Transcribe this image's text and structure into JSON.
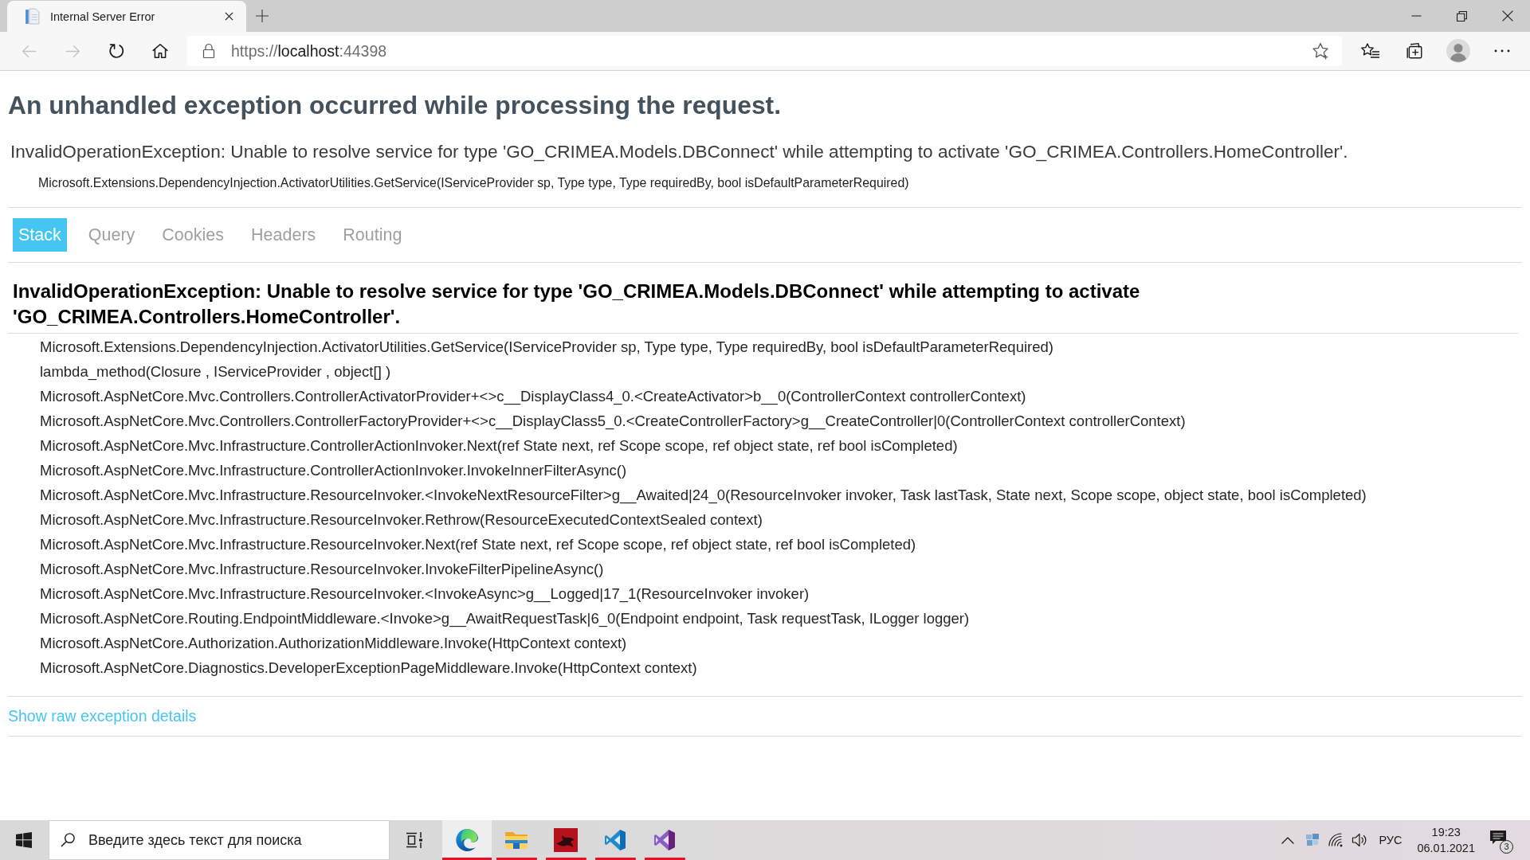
{
  "browser": {
    "tab": {
      "title": "Internal Server Error"
    },
    "toolbar": {
      "back": {
        "disabled": true
      },
      "forward": {
        "disabled": true
      },
      "url": {
        "scheme": "https://",
        "host": "localhost",
        "port": ":44398"
      }
    }
  },
  "page": {
    "title": "An unhandled exception occurred while processing the request.",
    "error_message": "InvalidOperationException: Unable to resolve service for type 'GO_CRIMEA.Models.DBConnect' while attempting to activate 'GO_CRIMEA.Controllers.HomeController'.",
    "error_location": "Microsoft.Extensions.DependencyInjection.ActivatorUtilities.GetService(IServiceProvider sp, Type type, Type requiredBy, bool isDefaultParameterRequired)",
    "tabs": [
      {
        "label": "Stack",
        "selected": true
      },
      {
        "label": "Query",
        "selected": false
      },
      {
        "label": "Cookies",
        "selected": false
      },
      {
        "label": "Headers",
        "selected": false
      },
      {
        "label": "Routing",
        "selected": false
      }
    ],
    "stack": {
      "exception": "InvalidOperationException: Unable to resolve service for type 'GO_CRIMEA.Models.DBConnect' while attempting to activate 'GO_CRIMEA.Controllers.HomeController'.",
      "frames": [
        "Microsoft.Extensions.DependencyInjection.ActivatorUtilities.GetService(IServiceProvider sp, Type type, Type requiredBy, bool isDefaultParameterRequired)",
        "lambda_method(Closure , IServiceProvider , object[] )",
        "Microsoft.AspNetCore.Mvc.Controllers.ControllerActivatorProvider+<>c__DisplayClass4_0.<CreateActivator>b__0(ControllerContext controllerContext)",
        "Microsoft.AspNetCore.Mvc.Controllers.ControllerFactoryProvider+<>c__DisplayClass5_0.<CreateControllerFactory>g__CreateController|0(ControllerContext controllerContext)",
        "Microsoft.AspNetCore.Mvc.Infrastructure.ControllerActionInvoker.Next(ref State next, ref Scope scope, ref object state, ref bool isCompleted)",
        "Microsoft.AspNetCore.Mvc.Infrastructure.ControllerActionInvoker.InvokeInnerFilterAsync()",
        "Microsoft.AspNetCore.Mvc.Infrastructure.ResourceInvoker.<InvokeNextResourceFilter>g__Awaited|24_0(ResourceInvoker invoker, Task lastTask, State next, Scope scope, object state, bool isCompleted)",
        "Microsoft.AspNetCore.Mvc.Infrastructure.ResourceInvoker.Rethrow(ResourceExecutedContextSealed context)",
        "Microsoft.AspNetCore.Mvc.Infrastructure.ResourceInvoker.Next(ref State next, ref Scope scope, ref object state, ref bool isCompleted)",
        "Microsoft.AspNetCore.Mvc.Infrastructure.ResourceInvoker.InvokeFilterPipelineAsync()",
        "Microsoft.AspNetCore.Mvc.Infrastructure.ResourceInvoker.<InvokeAsync>g__Logged|17_1(ResourceInvoker invoker)",
        "Microsoft.AspNetCore.Routing.EndpointMiddleware.<Invoke>g__AwaitRequestTask|6_0(Endpoint endpoint, Task requestTask, ILogger logger)",
        "Microsoft.AspNetCore.Authorization.AuthorizationMiddleware.Invoke(HttpContext context)",
        "Microsoft.AspNetCore.Diagnostics.DeveloperExceptionPageMiddleware.Invoke(HttpContext context)"
      ]
    },
    "raw_exception_link": "Show raw exception details"
  },
  "taskbar": {
    "search": {
      "placeholder": "Введите здесь текст для поиска"
    },
    "apps": [
      {
        "kind": "browser",
        "selected": true,
        "running": true
      },
      {
        "kind": "file-explorer",
        "selected": false,
        "running": true
      },
      {
        "kind": "app",
        "selected": false,
        "running": true
      },
      {
        "kind": "code-editor",
        "selected": false,
        "running": true
      },
      {
        "kind": "ide",
        "selected": false,
        "running": true
      }
    ],
    "tray": {
      "language": "РУС",
      "time": "19:23",
      "date": "06.01.2021",
      "notification_count": "3"
    }
  }
}
